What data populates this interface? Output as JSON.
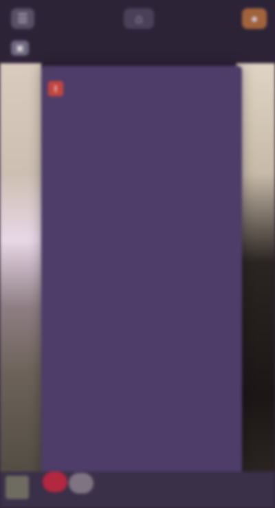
{
  "topbar": {
    "left_icon": "menu-icon",
    "center_icon": "home-icon",
    "right_icon": "profile-icon"
  },
  "subbar": {
    "icon": "document-icon",
    "title": ""
  },
  "panel": {
    "alert": {
      "icon": "warning-icon",
      "title": "",
      "subtitle": ""
    },
    "description": "",
    "section_title": "",
    "lines": [
      "",
      "",
      "",
      "",
      "",
      "",
      "",
      "",
      "",
      "",
      "",
      "",
      "",
      "",
      "",
      "",
      "",
      "",
      "",
      "",
      ""
    ]
  },
  "bottombar": {
    "thumb_icon": "thumbnail-icon",
    "record_icon": "record-icon",
    "secondary_icon": "circle-icon"
  },
  "colors": {
    "panel": "#4d3d68",
    "topbar": "#2c2337",
    "accent": "#e3735f",
    "alert": "#c4463f",
    "badge": "#a1633c"
  }
}
